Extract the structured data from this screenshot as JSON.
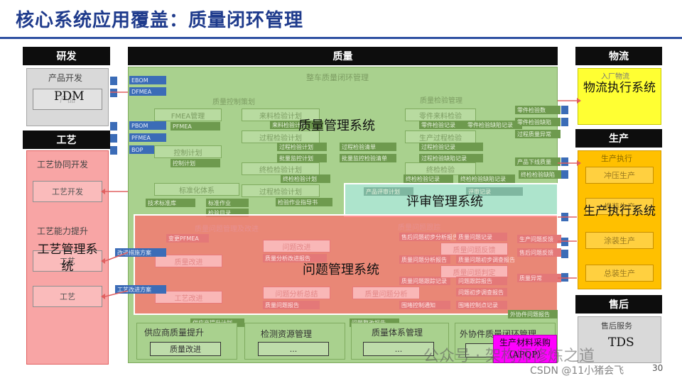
{
  "title": "核心系统应用覆盖：质量闭环管理",
  "page_number": "30",
  "columns": {
    "rd": "研发",
    "quality": "质量",
    "logistics": "物流",
    "process": "工艺",
    "production": "生产",
    "after_sales": "售后"
  },
  "rd": {
    "sub": "产品开发",
    "system": "PDM",
    "faint": "产品"
  },
  "process": {
    "group1": "工艺协同开发",
    "group1_box": "工艺开发",
    "group2": "工艺能力提升",
    "group2_box1": "工艺",
    "group2_box2": "工艺",
    "system": "工艺管理系统"
  },
  "logistics": {
    "sub": "入厂物流",
    "system": "物流执行系统"
  },
  "production": {
    "sub": "生产执行",
    "boxes": [
      "冲压生产",
      "焊装生产",
      "涂装生产",
      "总装生产"
    ],
    "system": "生产执行系统"
  },
  "after_sales": {
    "sub": "售后服务",
    "system": "TDS"
  },
  "quality": {
    "main": "整车质量闭环管理",
    "planning": "质量控制策划",
    "inspection": "质量检验管理",
    "problem": "质量问题管理及改进",
    "problem_track": "质量问题跟踪",
    "left_tags": [
      "EBOM",
      "DFMEA",
      "PBOM",
      "PFMEA",
      "BOP"
    ],
    "planning_boxes": [
      "FMEA管理",
      "控制计划",
      "标准化体系",
      "PFMEA",
      "控制计划"
    ],
    "plan_boxes": [
      "来料检验计划",
      "过程检验计划",
      "终检检验计划",
      "过程检验计划",
      "过程检验计划"
    ],
    "tags_mid": [
      "来料检验计划",
      "过程检验计划",
      "批量监控计划",
      "终检检验计划",
      "过程检验清单",
      "批量监控检验清单",
      "检验作业指导书"
    ],
    "inspect_boxes": [
      "零件来料检验",
      "生产过程检验",
      "终检检验",
      "过程检验"
    ],
    "tags_right": [
      "零件检验记录",
      "零件检验缺陷记录",
      "过程检验记录",
      "过程检验缺陷记录",
      "终检检验记录",
      "终检检验缺陷记录"
    ],
    "far_right_tags": [
      "零件检验数",
      "零件检验缺陷",
      "过程质量异常",
      "产品下线质量",
      "终检检验缺陷"
    ],
    "bottom_tags": [
      "技术标准库",
      "标准作业",
      "检验目录",
      "检验作业指导书"
    ],
    "problem_boxes": [
      "质量改进",
      "工艺改进",
      "问题改进",
      "问题分析总结",
      "质量问题分析",
      "质量问题判定",
      "质量问题反馈"
    ],
    "problem_tags": [
      "变更PFMEA",
      "质量分析改进报告",
      "质量问题报告",
      "售后问题初步分析报告",
      "质量问题分析报告",
      "质量问题初步调查报告",
      "问题初步调查报告",
      "质量问题跟踪记录",
      "问题跟踪报告",
      "围堵控制通知",
      "围堵控制点记录",
      "质量问题记录"
    ],
    "side_tags": [
      "改进措施方案",
      "工艺改进方案",
      "供应商提升计划",
      "问题整改报告",
      "外协件问题报告"
    ],
    "right_edge_tags": [
      "生产问题反馈",
      "售后问题反馈",
      "质量异常"
    ]
  },
  "overlays": {
    "qms": "质量管理系统",
    "review": "评审管理系统",
    "issue": "问题管理系统",
    "review_tags": [
      "产品评审计划",
      "评审记录"
    ]
  },
  "bottom_modules": {
    "supplier": "供应商质量提升",
    "supplier_box": "质量改进",
    "testing": "检测资源管理",
    "testing_box": "...",
    "system": "质量体系管理",
    "system_box": "...",
    "outsourced": "外协件质量闭环管理",
    "outsourced_box": "外协"
  },
  "purchase": {
    "label": "生产材料采购（APQP）"
  },
  "watermark": {
    "line1": "公众号 · 架构师修炼之道",
    "line2": "CSDN @11小猪会飞"
  },
  "colors": {
    "title": "#1f3b8c",
    "header": "#0d0d0d",
    "gray": "#d9d9d9",
    "red": "#f8a5a5",
    "yellow": "#ffc000",
    "green": "#a9d18e",
    "qms_overlay": "#ff6e6e",
    "review_overlay": "#afeeee",
    "purchase": "#ff00ff"
  }
}
